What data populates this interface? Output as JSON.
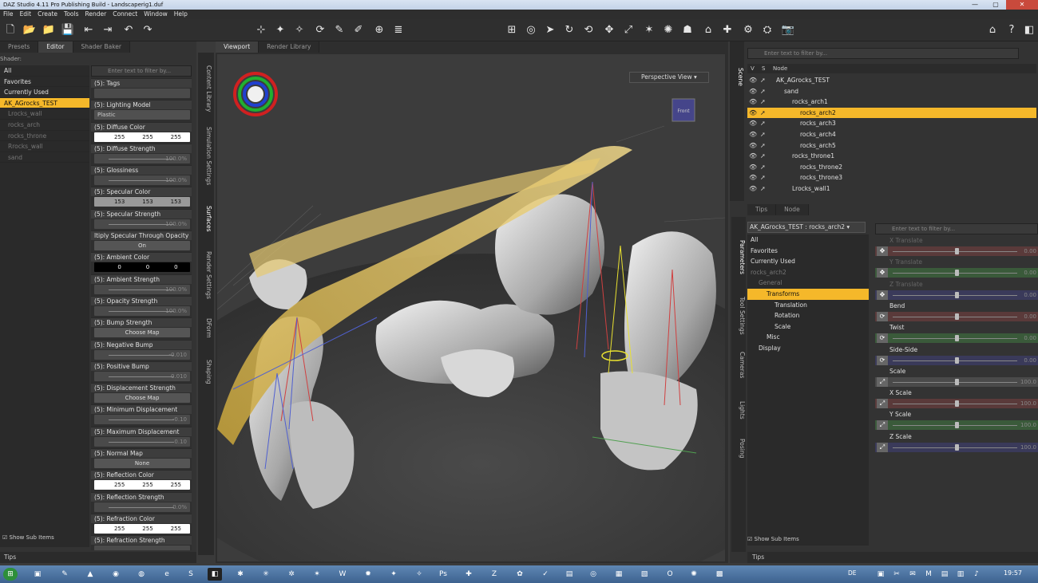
{
  "window": {
    "title": "DAZ Studio 4.11 Pro Publishing Build - Landscaperig1.duf"
  },
  "menu": [
    "File",
    "Edit",
    "Create",
    "Tools",
    "Render",
    "Connect",
    "Window",
    "Help"
  ],
  "left_panel": {
    "tabs": [
      "Presets",
      "Editor",
      "Shader Baker"
    ],
    "shader_label": "Shader:",
    "tree": [
      {
        "label": "All",
        "state": "normal"
      },
      {
        "label": "Favorites",
        "state": "normal"
      },
      {
        "label": "Currently Used",
        "state": "normal"
      },
      {
        "label": "AK_AGrocks_TEST",
        "state": "selected"
      },
      {
        "label": "Lrocks_wall",
        "state": "dim"
      },
      {
        "label": "rocks_arch",
        "state": "dim"
      },
      {
        "label": "rocks_throne",
        "state": "dim"
      },
      {
        "label": "Rrocks_wall",
        "state": "dim"
      },
      {
        "label": "sand",
        "state": "dim"
      }
    ],
    "search_placeholder": "Enter text to filter by...",
    "properties": [
      {
        "label": "(5): Tags",
        "kind": "text",
        "value": ""
      },
      {
        "label": "(5): Lighting Model",
        "kind": "dropdown",
        "value": "Plastic"
      },
      {
        "label": "(5): Diffuse Color",
        "kind": "color",
        "tone": "white",
        "values": [
          "255",
          "255",
          "255"
        ]
      },
      {
        "label": "(5): Diffuse Strength",
        "kind": "slider",
        "value": "100.0%"
      },
      {
        "label": "(5): Glossiness",
        "kind": "slider",
        "value": "100.0%"
      },
      {
        "label": "(5): Specular Color",
        "kind": "color",
        "tone": "gray",
        "values": [
          "153",
          "153",
          "153"
        ]
      },
      {
        "label": "(5): Specular Strength",
        "kind": "slider",
        "value": "100.0%"
      },
      {
        "label": "ltiply Specular Through Opacity",
        "kind": "button",
        "value": "On"
      },
      {
        "label": "(5): Ambient Color",
        "kind": "color",
        "tone": "black",
        "values": [
          "0",
          "0",
          "0"
        ]
      },
      {
        "label": "(5): Ambient Strength",
        "kind": "slider",
        "value": "100.0%"
      },
      {
        "label": "(5): Opacity Strength",
        "kind": "slider",
        "value": "100.0%"
      },
      {
        "label": "(5): Bump Strength",
        "kind": "button",
        "value": "Choose Map"
      },
      {
        "label": "(5): Negative Bump",
        "kind": "slider",
        "value": "-0.010"
      },
      {
        "label": "(5): Positive Bump",
        "kind": "slider",
        "value": "0.010"
      },
      {
        "label": "(5): Displacement Strength",
        "kind": "button",
        "value": "Choose Map"
      },
      {
        "label": "(5): Minimum Displacement",
        "kind": "slider",
        "value": "-0.10"
      },
      {
        "label": "(5): Maximum Displacement",
        "kind": "slider",
        "value": "0.10"
      },
      {
        "label": "(5): Normal Map",
        "kind": "button",
        "value": "None"
      },
      {
        "label": "(5): Reflection Color",
        "kind": "color",
        "tone": "white",
        "values": [
          "255",
          "255",
          "255"
        ]
      },
      {
        "label": "(5): Reflection Strength",
        "kind": "slider",
        "value": "0.0%"
      },
      {
        "label": "(5): Refraction Color",
        "kind": "color",
        "tone": "white",
        "values": [
          "255",
          "255",
          "255"
        ]
      },
      {
        "label": "(5): Refraction Strength",
        "kind": "slider",
        "value": ""
      }
    ],
    "show_sub_items": "Show Sub Items",
    "vtabs": [
      "Content Library",
      "Simulation Settings",
      "Surfaces",
      "Render Settings",
      "DForm",
      "Shaping"
    ],
    "tips": "Tips"
  },
  "viewport": {
    "tabs": [
      "Viewport",
      "Render Library"
    ],
    "camera": "Perspective View",
    "cube_label": "Front"
  },
  "scene": {
    "search_placeholder": "Enter text to filter by...",
    "header": {
      "v": "V",
      "s": "S",
      "node": "Node"
    },
    "vtab": "Scene",
    "nodes": [
      {
        "label": "AK_AGrocks_TEST",
        "depth": 0,
        "state": "normal"
      },
      {
        "label": "sand",
        "depth": 1,
        "state": "normal"
      },
      {
        "label": "rocks_arch1",
        "depth": 2,
        "state": "normal"
      },
      {
        "label": "rocks_arch2",
        "depth": 3,
        "state": "selected"
      },
      {
        "label": "rocks_arch3",
        "depth": 3,
        "state": "normal"
      },
      {
        "label": "rocks_arch4",
        "depth": 3,
        "state": "normal"
      },
      {
        "label": "rocks_arch5",
        "depth": 3,
        "state": "normal"
      },
      {
        "label": "rocks_throne1",
        "depth": 2,
        "state": "normal"
      },
      {
        "label": "rocks_throne2",
        "depth": 3,
        "state": "normal"
      },
      {
        "label": "rocks_throne3",
        "depth": 3,
        "state": "normal"
      },
      {
        "label": "Lrocks_wall1",
        "depth": 2,
        "state": "normal"
      }
    ],
    "tabs2": [
      "Tips",
      "Node"
    ]
  },
  "parameters": {
    "node_selector": "AK_AGrocks_TEST : rocks_arch2",
    "search_placeholder": "Enter text to filter by...",
    "vtabs": [
      "Parameters",
      "Tool Settings",
      "Cameras",
      "Lights",
      "Posing"
    ],
    "tree": [
      {
        "label": "All",
        "depth": 0,
        "state": "normal"
      },
      {
        "label": "Favorites",
        "depth": 0,
        "state": "normal"
      },
      {
        "label": "Currently Used",
        "depth": 0,
        "state": "normal"
      },
      {
        "label": "rocks_arch2",
        "depth": 0,
        "state": "dim"
      },
      {
        "label": "General",
        "depth": 1,
        "state": "dim"
      },
      {
        "label": "Transforms",
        "depth": 2,
        "state": "selected"
      },
      {
        "label": "Translation",
        "depth": 3,
        "state": "normal"
      },
      {
        "label": "Rotation",
        "depth": 3,
        "state": "normal"
      },
      {
        "label": "Scale",
        "depth": 3,
        "state": "normal"
      },
      {
        "label": "Misc",
        "depth": 2,
        "state": "normal"
      },
      {
        "label": "Display",
        "depth": 1,
        "state": "normal"
      }
    ],
    "sliders": [
      {
        "label": "X Translate",
        "value": "0.00",
        "dim": true,
        "color": "#5a3a3a",
        "icon": "move-icon",
        "pos": 0.5
      },
      {
        "label": "Y Translate",
        "value": "0.00",
        "dim": true,
        "color": "#3a5a3a",
        "icon": "move-icon",
        "pos": 0.5
      },
      {
        "label": "Z Translate",
        "value": "0.00",
        "dim": true,
        "color": "#3a3a5a",
        "icon": "move-icon",
        "pos": 0.5
      },
      {
        "label": "Bend",
        "value": "0.00",
        "dim": false,
        "color": "#5a3a3a",
        "icon": "rotate-icon",
        "pos": 0.5
      },
      {
        "label": "Twist",
        "value": "0.00",
        "dim": false,
        "color": "#3a5a3a",
        "icon": "rotate-icon",
        "pos": 0.5
      },
      {
        "label": "Side-Side",
        "value": "0.00",
        "dim": false,
        "color": "#3a3a5a",
        "icon": "rotate-icon",
        "pos": 0.5
      },
      {
        "label": "Scale",
        "value": "100.0",
        "dim": false,
        "color": "#4a4a4a",
        "icon": "scale-icon",
        "pos": 0.5
      },
      {
        "label": "X Scale",
        "value": "100.0",
        "dim": false,
        "color": "#5a3a3a",
        "icon": "scale-icon",
        "pos": 0.5
      },
      {
        "label": "Y Scale",
        "value": "100.0",
        "dim": false,
        "color": "#3a5a3a",
        "icon": "scale-icon",
        "pos": 0.5
      },
      {
        "label": "Z Scale",
        "value": "100.0",
        "dim": false,
        "color": "#3a3a5a",
        "icon": "scale-icon",
        "pos": 0.5
      }
    ],
    "show_sub_items": "Show Sub Items",
    "tips": "Tips"
  },
  "taskbar": {
    "lang": "DE",
    "clock": "19:57"
  }
}
